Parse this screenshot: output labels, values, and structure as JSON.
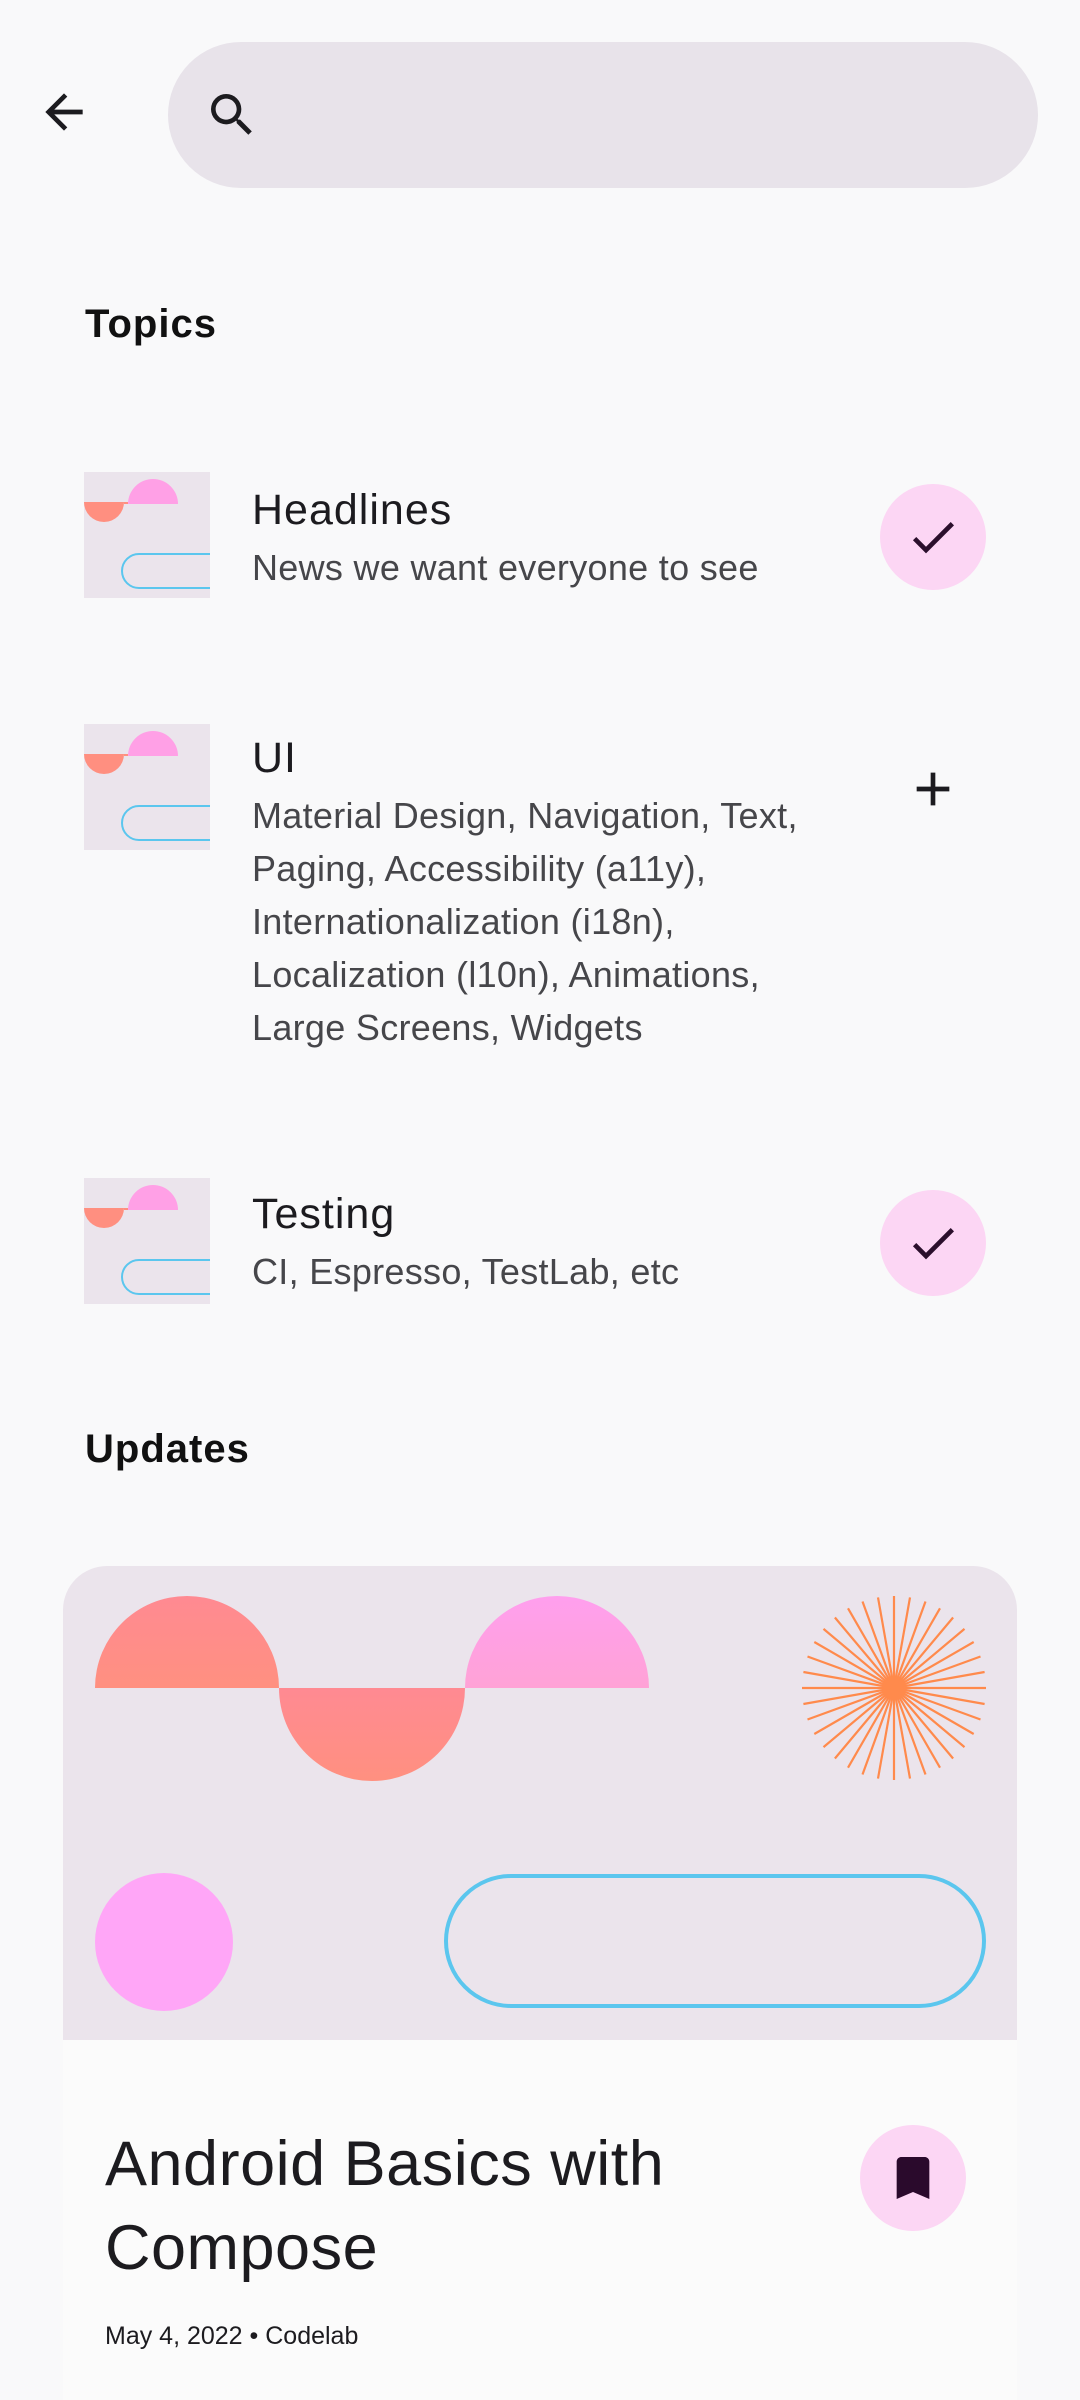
{
  "search": {
    "value": "",
    "placeholder": ""
  },
  "icons": {
    "back": "arrow-back-icon",
    "search": "search-icon",
    "check": "check-icon",
    "add": "add-icon",
    "bookmark": "bookmark-icon"
  },
  "colors": {
    "background": "#f9f9fa",
    "search_bar": "#e8e3ea",
    "followed_button": "#fcd6f4",
    "check_color": "#2b0f2c",
    "bookmark_color": "#2a0a2c",
    "image_background": "#ebe4ec",
    "coral": "#ff8f80",
    "pink": "#ffa0e6",
    "sky": "#5bc6ee",
    "orange": "#ff8a4c"
  },
  "topics_section": {
    "title": "Topics",
    "items": [
      {
        "title": "Headlines",
        "description": "News we want everyone to see",
        "followed": true,
        "icon": "check-icon"
      },
      {
        "title": "UI",
        "description": "Material Design, Navigation, Text, Paging, Accessibility (a11y), Internationalization (i18n), Localization (l10n), Animations, Large Screens, Widgets",
        "followed": false,
        "icon": "add-icon"
      },
      {
        "title": "Testing",
        "description": "CI, Espresso, TestLab, etc",
        "followed": true,
        "icon": "check-icon"
      }
    ]
  },
  "updates_section": {
    "title": "Updates",
    "cards": [
      {
        "title": "Android Basics with Compose",
        "meta": "May 4, 2022 • Codelab",
        "bookmarked": true
      }
    ]
  }
}
